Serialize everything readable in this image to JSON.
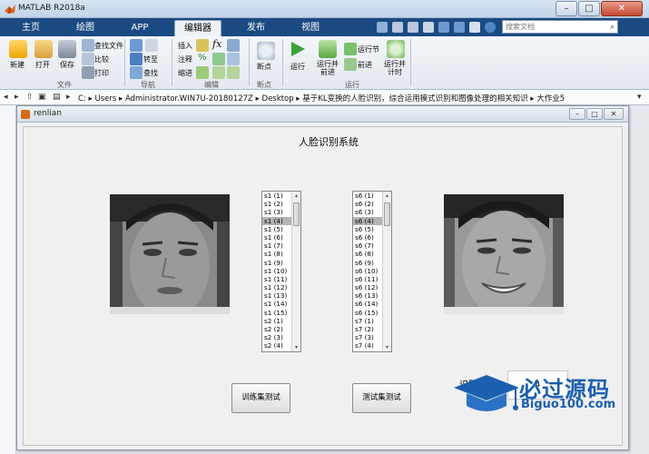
{
  "app": {
    "title": "MATLAB R2018a",
    "window_min": "–",
    "window_max": "□",
    "window_close": "✕"
  },
  "tabs": [
    {
      "label": "主页"
    },
    {
      "label": "绘图"
    },
    {
      "label": "APP"
    },
    {
      "label": "编辑器"
    },
    {
      "label": "发布"
    },
    {
      "label": "视图"
    }
  ],
  "search": {
    "placeholder": "搜索文档"
  },
  "toolstrip": {
    "new": "新建",
    "open": "打开",
    "save": "保存",
    "find_files": "查找文件",
    "compare": "比较",
    "print": "打印",
    "goto": "转至",
    "find": "查找",
    "insert": "插入",
    "comment": "注释",
    "indent": "缩进",
    "breakpoints": "断点",
    "run": "运行",
    "run_advance": "运行并\n前进",
    "run_section": "运行节",
    "advance": "前进",
    "run_time": "运行并\n计时",
    "groups": {
      "file": "文件",
      "navigate": "导航",
      "edit": "编辑",
      "breakpoints": "断点",
      "run": "运行"
    }
  },
  "address": {
    "path": "C:  ▸  Users  ▸  Administrator.WIN7U-20180127Z  ▸  Desktop  ▸  基于KL变换的人脸识别，综合运用模式识别和图像处理的相关知识  ▸  大作业5"
  },
  "figure": {
    "title": "renlian",
    "heading": "人脸识别系统",
    "list_left": {
      "items": [
        "s1 (1)",
        "s1 (2)",
        "s1 (3)",
        "s1 (4)",
        "s1 (5)",
        "s1 (6)",
        "s1 (7)",
        "s1 (8)",
        "s1 (9)",
        "s1 (10)",
        "s1 (11)",
        "s1 (12)",
        "s1 (13)",
        "s1 (14)",
        "s1 (15)",
        "s2 (1)",
        "s2 (2)",
        "s2 (3)",
        "s2 (4)"
      ],
      "selected_index": 3
    },
    "list_right": {
      "items": [
        "s6 (1)",
        "s6 (2)",
        "s6 (3)",
        "s6 (4)",
        "s6 (5)",
        "s6 (6)",
        "s6 (7)",
        "s6 (8)",
        "s6 (9)",
        "s6 (10)",
        "s6 (11)",
        "s6 (12)",
        "s6 (13)",
        "s6 (14)",
        "s6 (15)",
        "s7 (1)",
        "s7 (2)",
        "s7 (3)",
        "s7 (4)"
      ],
      "selected_index": 3
    },
    "train_button": "训练集测试",
    "test_button": "测试集测试",
    "result_label": "识别结果",
    "result_value": "4"
  },
  "watermark": {
    "cn": "必过源码",
    "en": "Biguo100.com"
  },
  "colors": {
    "tab_strip": "#1b4a82",
    "watermark": "#1b5fb0"
  }
}
